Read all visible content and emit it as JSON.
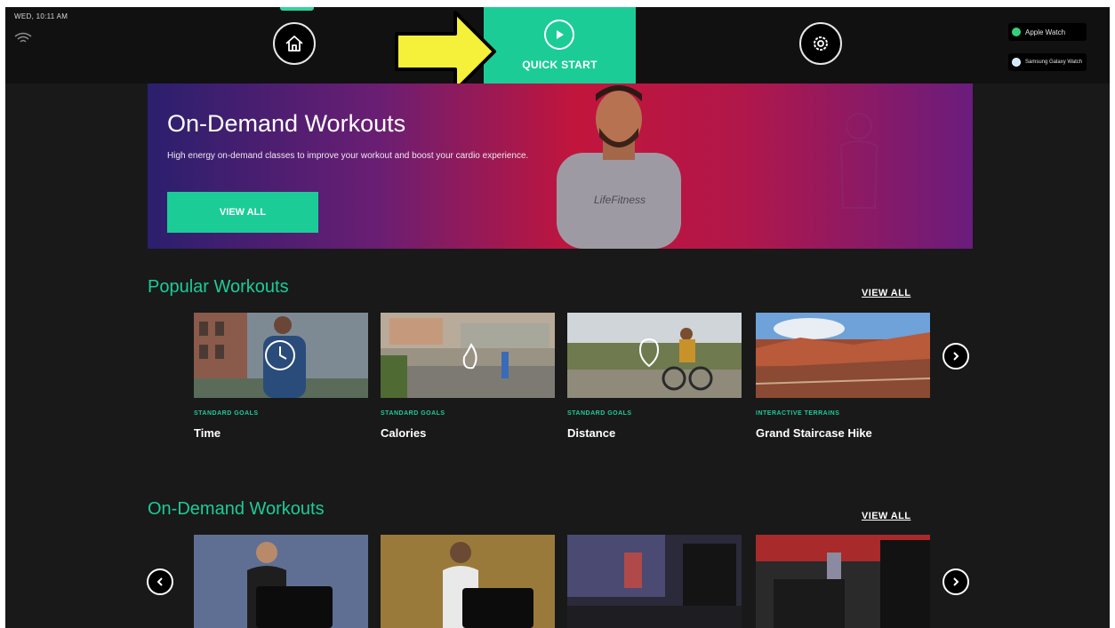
{
  "status": {
    "clock": "WED, 10:11 AM",
    "wifi_icon": "wifi-icon"
  },
  "nav": {
    "home_icon": "home-icon",
    "quick_start": {
      "label": "QUICK START",
      "icon": "play-icon"
    },
    "settings_icon": "gear-icon"
  },
  "connections": [
    {
      "label": "Apple Watch",
      "icon": "apple-watch-icon"
    },
    {
      "label": "Samsung Galaxy Watch",
      "icon": "samsung-icon"
    }
  ],
  "hero": {
    "title": "On-Demand Workouts",
    "subtitle": "High energy on-demand classes to improve your workout and boost your cardio experience.",
    "button": "VIEW ALL"
  },
  "popular": {
    "title": "Popular Workouts",
    "view_all": "VIEW ALL",
    "items": [
      {
        "category": "STANDARD GOALS",
        "title": "Time"
      },
      {
        "category": "STANDARD GOALS",
        "title": "Calories"
      },
      {
        "category": "STANDARD GOALS",
        "title": "Distance"
      },
      {
        "category": "INTERACTIVE TERRAINS",
        "title": "Grand Staircase Hike"
      }
    ]
  },
  "ondemand": {
    "title": "On-Demand Workouts",
    "view_all": "VIEW ALL"
  },
  "colors": {
    "accent": "#1ccc97",
    "background": "#191919",
    "annotation_arrow": "#f5f03a"
  }
}
